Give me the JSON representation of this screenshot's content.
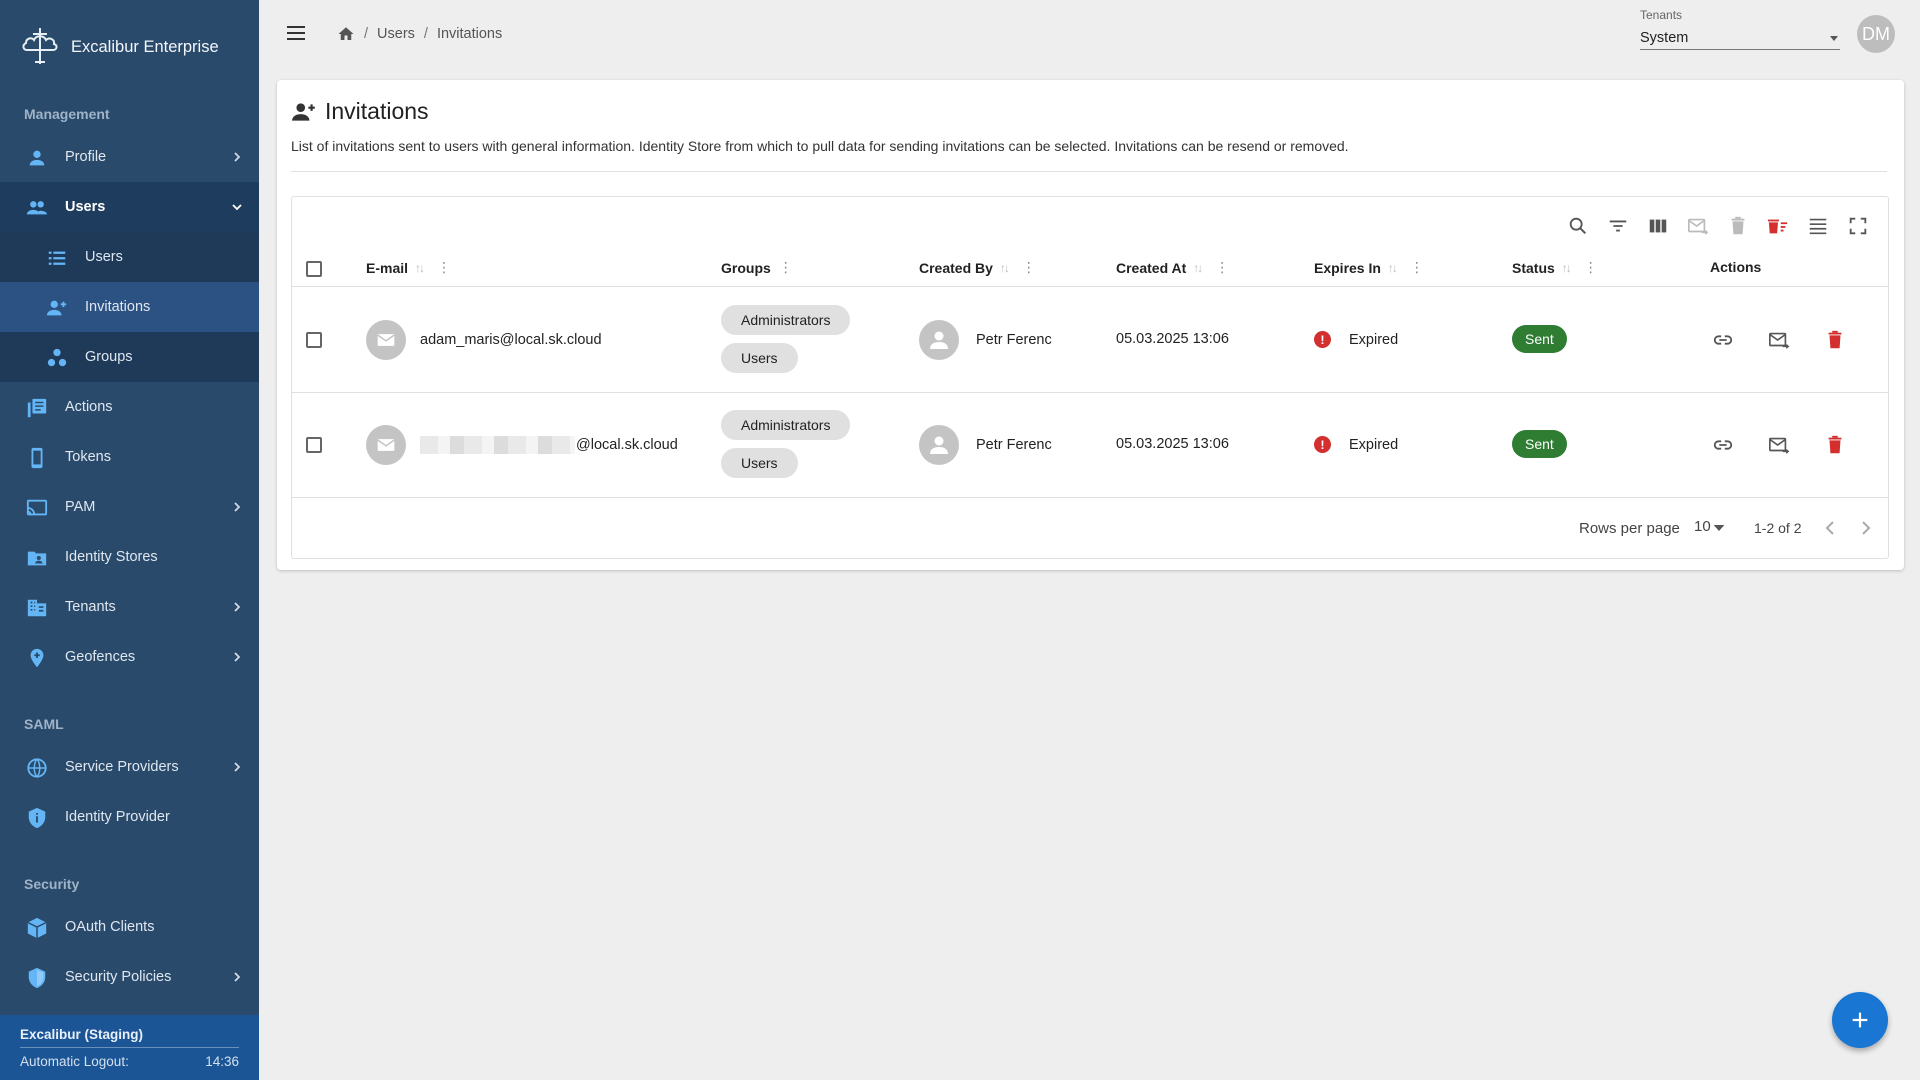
{
  "app": {
    "title": "Excalibur Enterprise"
  },
  "sidebar": {
    "sections": {
      "management": "Management",
      "saml": "SAML",
      "security": "Security"
    },
    "items": {
      "profile": "Profile",
      "users": "Users",
      "users_list": "Users",
      "invitations": "Invitations",
      "groups": "Groups",
      "actions": "Actions",
      "tokens": "Tokens",
      "pam": "PAM",
      "identity_stores": "Identity Stores",
      "tenants": "Tenants",
      "geofences": "Geofences",
      "service_providers": "Service Providers",
      "identity_provider": "Identity Provider",
      "oauth_clients": "OAuth Clients",
      "security_policies": "Security Policies"
    },
    "footer": {
      "title": "Excalibur (Staging)",
      "logout_label": "Automatic Logout:",
      "logout_time": "14:36"
    }
  },
  "breadcrumb": {
    "users": "Users",
    "invitations": "Invitations",
    "separator": "/"
  },
  "tenant": {
    "label": "Tenants",
    "value": "System"
  },
  "user": {
    "initials": "DM"
  },
  "page": {
    "title": "Invitations",
    "description": "List of invitations sent to users with general information. Identity Store from which to pull data for sending invitations can be selected. Invitations can be resend or removed."
  },
  "table": {
    "columns": {
      "email": "E-mail",
      "groups": "Groups",
      "created_by": "Created By",
      "created_at": "Created At",
      "expires_in": "Expires In",
      "status": "Status",
      "actions": "Actions"
    },
    "rows": [
      {
        "email": "adam_maris@local.sk.cloud",
        "groups": [
          "Administrators",
          "Users"
        ],
        "created_by": "Petr Ferenc",
        "created_at": "05.03.2025 13:06",
        "expires_in": "Expired",
        "status": "Sent"
      },
      {
        "email": "@local.sk.cloud",
        "groups": [
          "Administrators",
          "Users"
        ],
        "created_by": "Petr Ferenc",
        "created_at": "05.03.2025 13:06",
        "expires_in": "Expired",
        "status": "Sent"
      }
    ],
    "pagination": {
      "rows_per_page_label": "Rows per page",
      "rows_per_page": "10",
      "range": "1-2 of 2"
    }
  },
  "colors": {
    "sidebar": "#2a4a6b",
    "accent": "#1976d2",
    "status_sent": "#2e7d32",
    "danger": "#d32f2f"
  }
}
